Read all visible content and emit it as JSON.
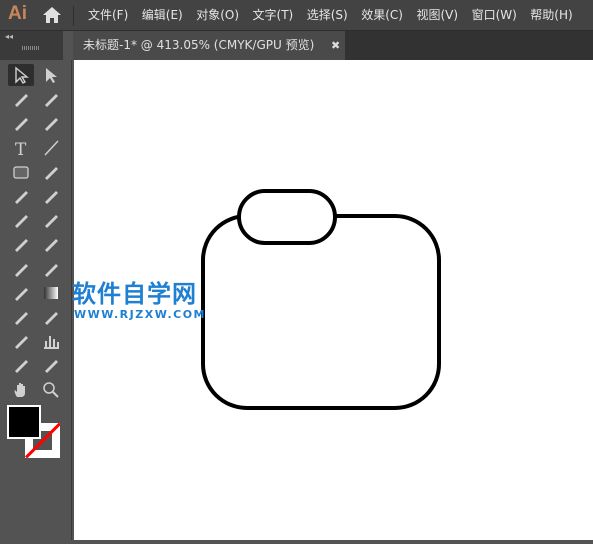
{
  "app": {
    "logo": "Ai"
  },
  "menu": [
    "文件(F)",
    "编辑(E)",
    "对象(O)",
    "文字(T)",
    "选择(S)",
    "效果(C)",
    "视图(V)",
    "窗口(W)",
    "帮助(H)"
  ],
  "tab": {
    "title": "未标题-1* @ 413.05% (CMYK/GPU 预览)",
    "close": "✖"
  },
  "tools": [
    "selection",
    "direct-selection",
    "magic-wand",
    "lasso",
    "pen",
    "curvature",
    "type",
    "line-segment",
    "rectangle",
    "paintbrush",
    "shaper",
    "eraser",
    "reflect",
    "scale",
    "warp",
    "puppet-warp",
    "shape-builder",
    "perspective-grid",
    "mesh",
    "gradient",
    "eyedropper",
    "blend",
    "symbol-sprayer",
    "column-graph",
    "artboard",
    "slice",
    "hand",
    "zoom"
  ],
  "colors": {
    "fill": "#000000",
    "stroke": "none",
    "accent": "#c8875a",
    "watermark": "#1f7fd2"
  },
  "watermark": {
    "title": "软件自学网",
    "url": "WWW.RJZXW.COM"
  }
}
